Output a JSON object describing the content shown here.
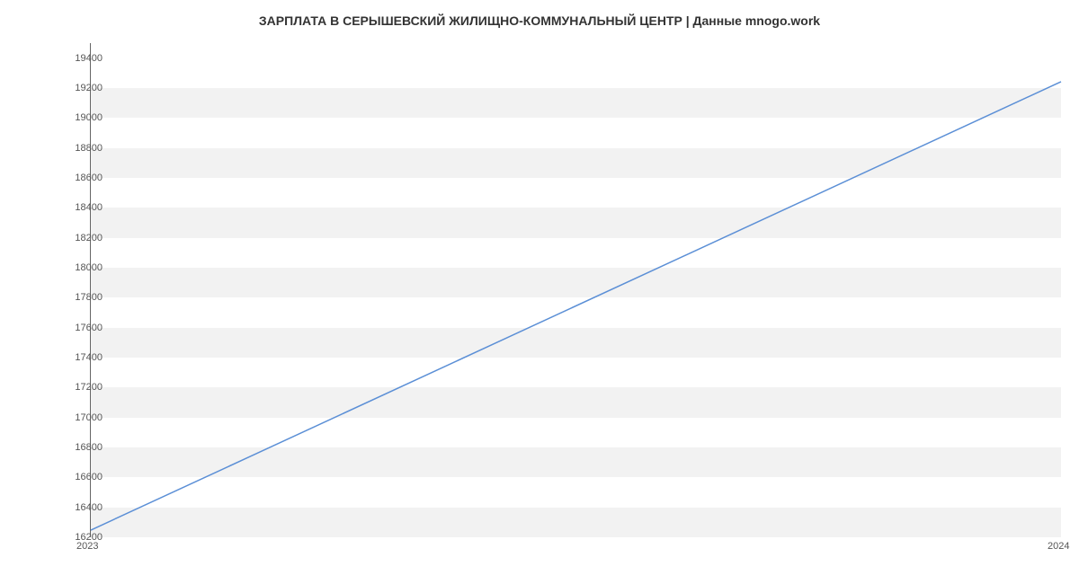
{
  "chart_data": {
    "type": "line",
    "title": "ЗАРПЛАТА В СЕРЫШЕВСКИЙ ЖИЛИЩНО-КОММУНАЛЬНЫЙ ЦЕНТР | Данные mnogo.work",
    "x": [
      2023,
      2024
    ],
    "values": [
      16242,
      19242
    ],
    "xlabel": "",
    "ylabel": "",
    "xlim": [
      2023,
      2024
    ],
    "ylim": [
      16200,
      19500
    ],
    "x_ticks": [
      2023,
      2024
    ],
    "y_ticks": [
      16200,
      16400,
      16600,
      16800,
      17000,
      17200,
      17400,
      17600,
      17800,
      18000,
      18200,
      18400,
      18600,
      18800,
      19000,
      19200,
      19400
    ],
    "grid": true,
    "line_color": "#5b8fd6"
  }
}
